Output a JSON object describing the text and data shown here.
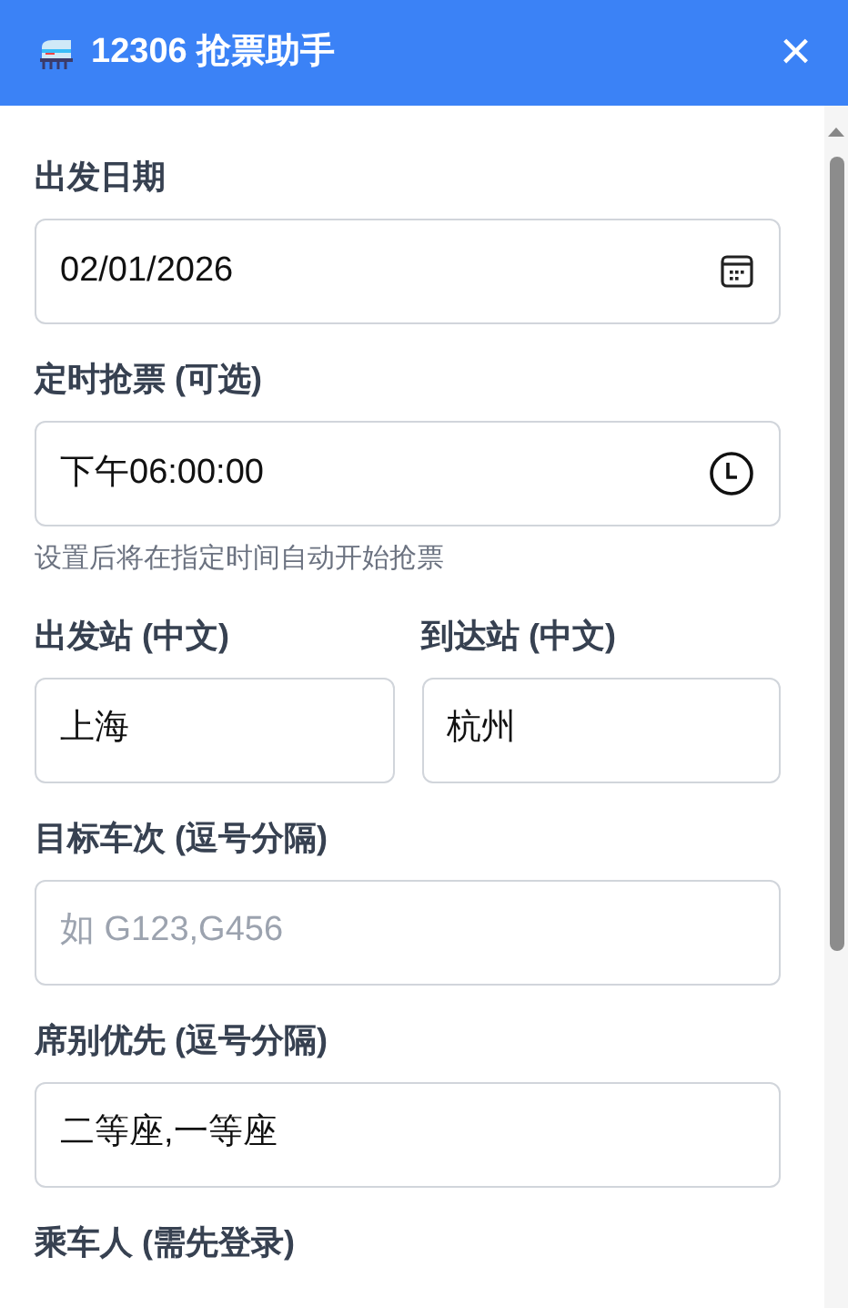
{
  "header": {
    "title": "12306 抢票助手",
    "close": "×"
  },
  "form": [
    {
      "kind": "date",
      "label": "出发日期",
      "value": "02/01/2026"
    },
    {
      "kind": "time",
      "label": "定时抢票 (可选)",
      "value": "下午06:00:00",
      "hint": "设置后将在指定时间自动开始抢票"
    },
    {
      "kind": "pair",
      "items": [
        {
          "label": "出发站 (中文)",
          "value": "上海"
        },
        {
          "label": "到达站 (中文)",
          "value": "杭州"
        }
      ]
    },
    {
      "kind": "text",
      "label": "目标车次 (逗号分隔)",
      "placeholder": "如 G123,G456"
    },
    {
      "kind": "text",
      "label": "席别优先 (逗号分隔)",
      "value": "二等座,一等座"
    },
    {
      "kind": "heading",
      "label": "乘车人 (需先登录)"
    }
  ]
}
